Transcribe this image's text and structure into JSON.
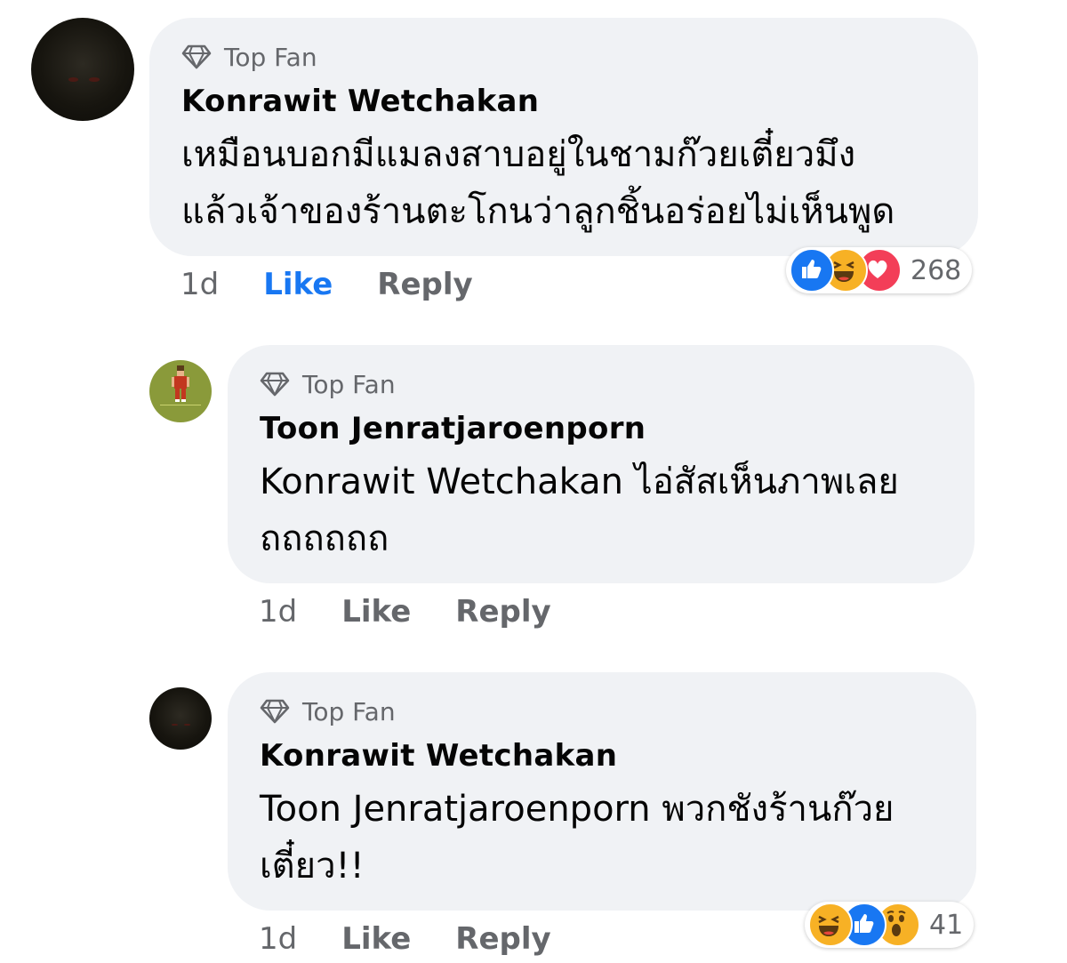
{
  "comments": [
    {
      "badge": "Top Fan",
      "author": "Konrawit Wetchakan",
      "text": "เหมือนบอกมีแมลงสาบอยู่ในชามก๊วยเตี๋ยวมึง\nแล้วเจ้าของร้านตะโกนว่าลูกชิ้นอร่อยไม่เห็นพูด",
      "time": "1d",
      "like_label": "Like",
      "reply_label": "Reply",
      "reactions": [
        "like",
        "haha",
        "love"
      ],
      "reaction_count": "268"
    },
    {
      "badge": "Top Fan",
      "author": "Toon Jenratjaroenporn",
      "text": "Konrawit Wetchakan ไอ่สัสเห็นภาพเลย\nถถถถถถ",
      "time": "1d",
      "like_label": "Like",
      "reply_label": "Reply"
    },
    {
      "badge": "Top Fan",
      "author": "Konrawit Wetchakan",
      "text": "Toon Jenratjaroenporn พวกชังร้านก๊วย\nเตี๋ยว!!",
      "time": "1d",
      "like_label": "Like",
      "reply_label": "Reply",
      "reactions": [
        "haha",
        "like",
        "wow"
      ],
      "reaction_count": "41"
    }
  ],
  "colors": {
    "bubble": "#f0f2f5",
    "link_active": "#1877f2",
    "secondary_text": "#65676b"
  }
}
